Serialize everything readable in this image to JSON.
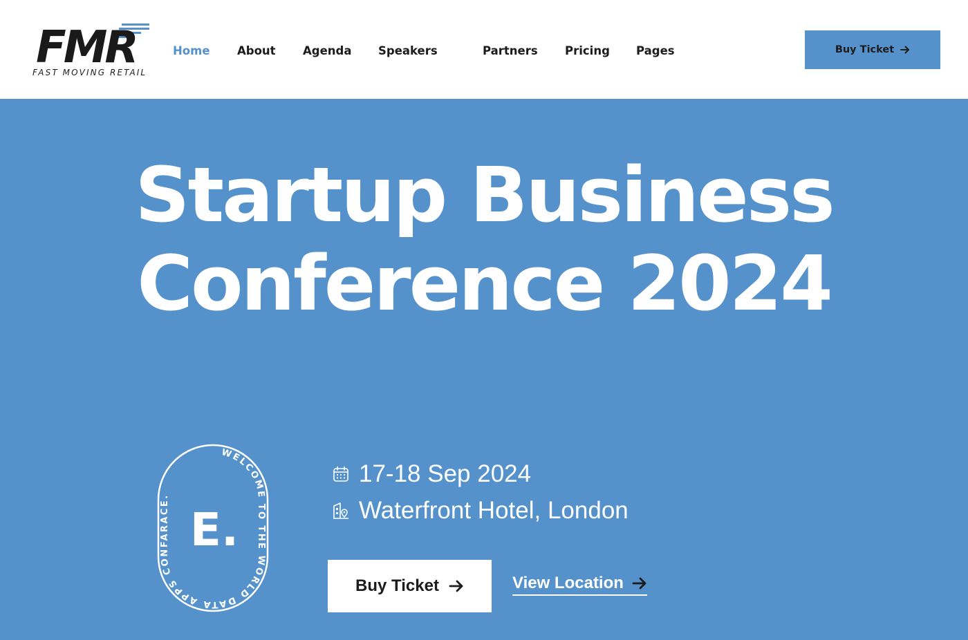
{
  "header": {
    "logo_text": "FMR",
    "logo_tagline": "FAST MOVING RETAIL",
    "nav": [
      {
        "label": "Home",
        "active": true
      },
      {
        "label": "About",
        "active": false
      },
      {
        "label": "Agenda",
        "active": false
      },
      {
        "label": "Speakers",
        "active": false
      },
      {
        "label": "Partners",
        "active": false
      },
      {
        "label": "Pricing",
        "active": false
      },
      {
        "label": "Pages",
        "active": false
      }
    ],
    "cta_label": "Buy Ticket"
  },
  "hero": {
    "title_line1": "Startup Business",
    "title_line2": "Conference 2024",
    "badge": {
      "letter": "E.",
      "ring_text": "WELCOME TO THE WORLD DATA APPS CONFARACE."
    },
    "date": "17-18 Sep 2024",
    "location": "Waterfront Hotel, London",
    "buy_label": "Buy Ticket",
    "view_location_label": "View Location"
  },
  "colors": {
    "accent": "#5591cb",
    "dark": "#1c1c1c",
    "white": "#ffffff"
  }
}
